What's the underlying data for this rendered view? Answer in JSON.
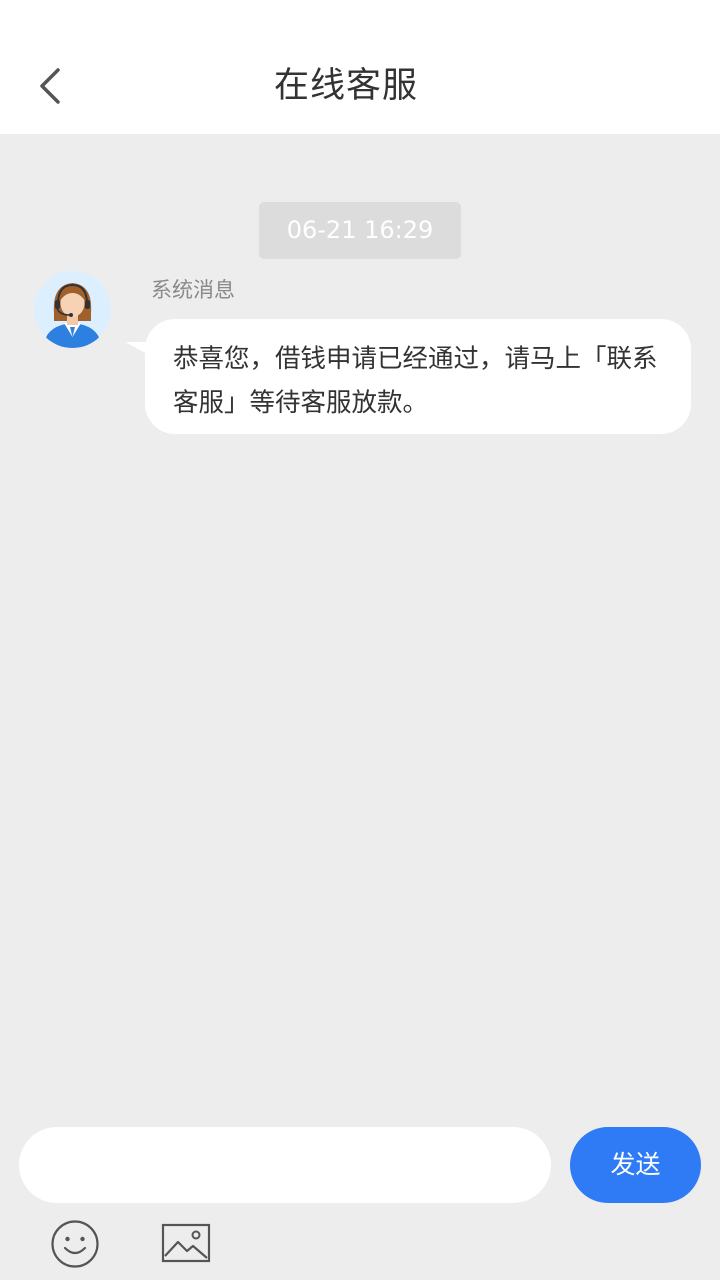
{
  "header": {
    "title": "在线客服",
    "back_icon": "chevron-left-icon"
  },
  "chat": {
    "timestamp": "06-21 16:29",
    "messages": [
      {
        "sender": "系统消息",
        "avatar": "customer-service-agent-avatar",
        "text": "恭喜您，借钱申请已经通过，请马上「联系客服」等待客服放款。"
      }
    ]
  },
  "composer": {
    "input_value": "",
    "send_label": "发送",
    "emoji_icon": "smiley-face-icon",
    "image_icon": "image-icon"
  },
  "colors": {
    "accent": "#2f7bf6",
    "background": "#ededed",
    "bubble": "#ffffff",
    "timestamp_bg": "#dcdcdc"
  }
}
